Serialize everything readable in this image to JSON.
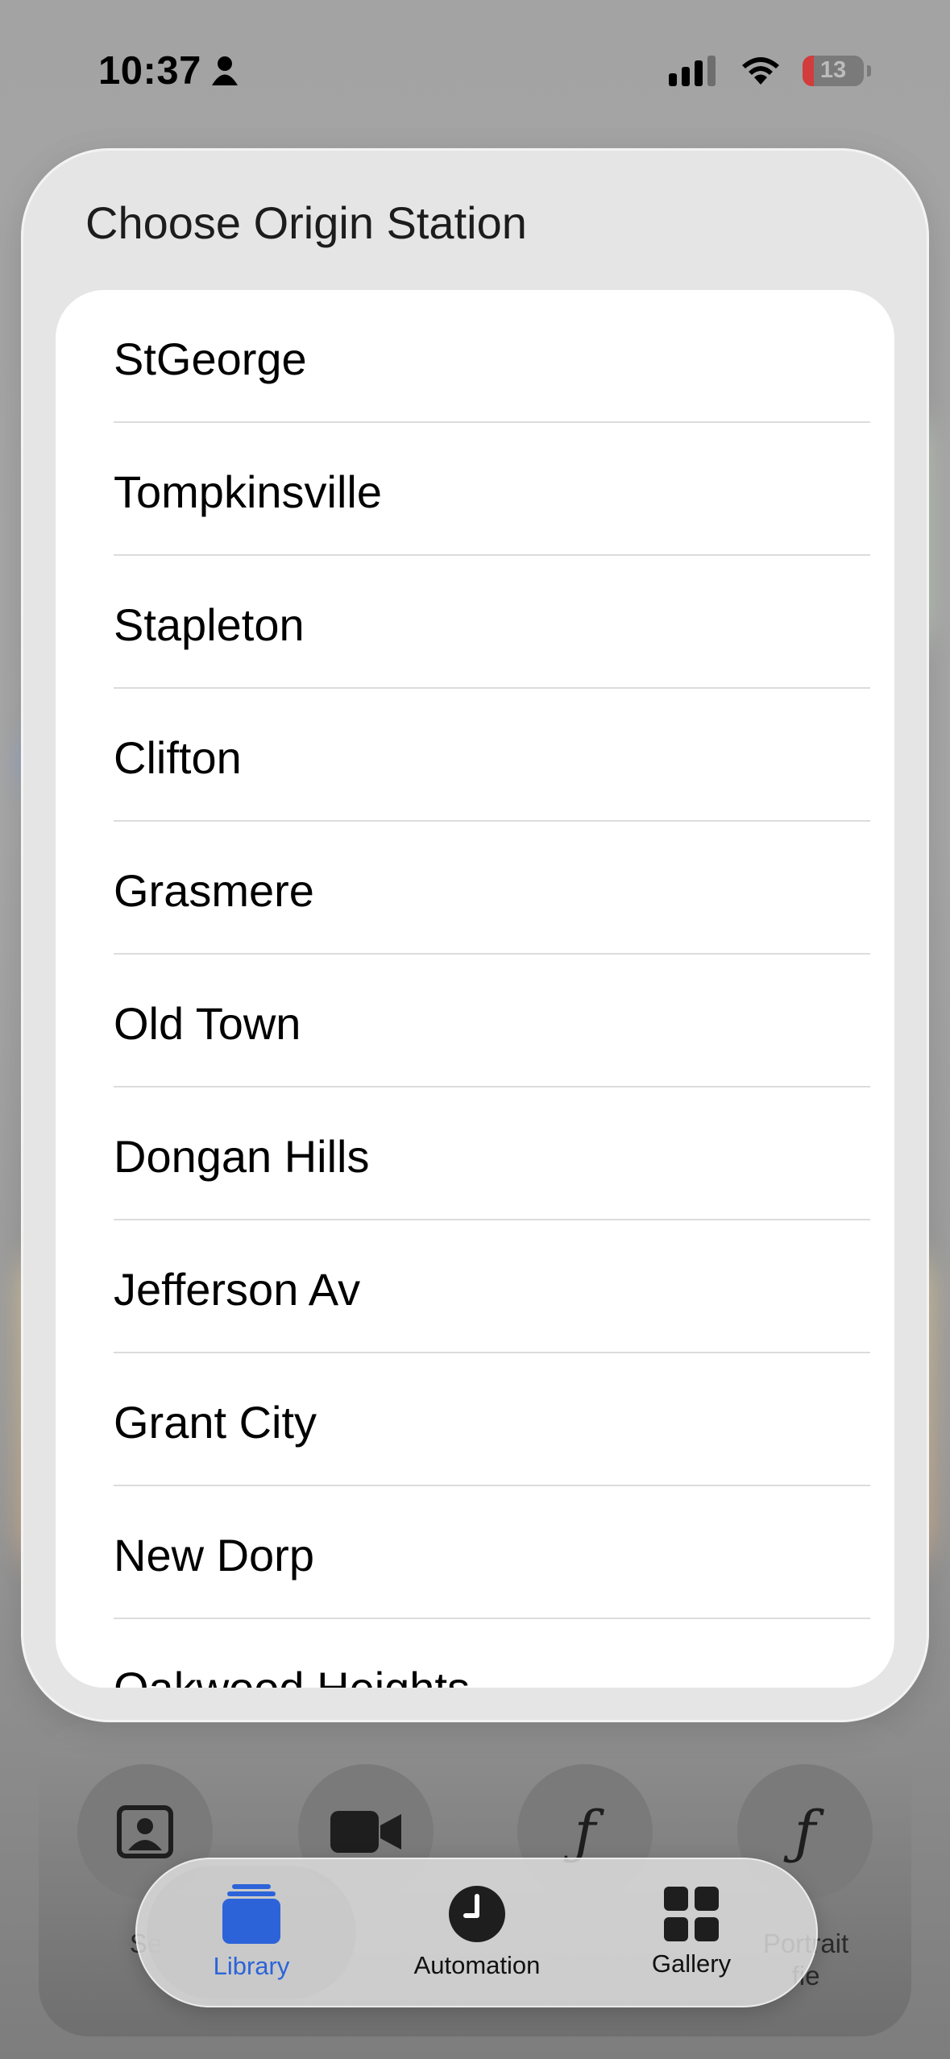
{
  "status_bar": {
    "time": "10:37",
    "battery_level": "13"
  },
  "sheet": {
    "title": "Choose Origin Station",
    "stations": [
      "StGeorge",
      "Tompkinsville",
      "Stapleton",
      "Clifton",
      "Grasmere",
      "Old Town",
      "Dongan Hills",
      "Jefferson Av",
      "Grant City",
      "New Dorp",
      "Oakwood Heights"
    ]
  },
  "widget_panel": {
    "actions": [
      {
        "label": "Se",
        "icon": "portrait-icon"
      },
      {
        "label": "",
        "icon": "video-camera-icon"
      },
      {
        "label": "",
        "icon": "function-icon"
      },
      {
        "label": "Portrait\nfie",
        "icon": "function-icon"
      }
    ]
  },
  "tab_bar": {
    "tabs": [
      {
        "label": "Library",
        "icon": "library-stack-icon",
        "active": true
      },
      {
        "label": "Automation",
        "icon": "clock-icon",
        "active": false
      },
      {
        "label": "Gallery",
        "icon": "grid-icon",
        "active": false
      }
    ]
  },
  "colors": {
    "accent": "#2c63d9",
    "sheet_background": "#e5e5e5",
    "list_background": "#ffffff",
    "battery_low": "#d23c3c"
  }
}
